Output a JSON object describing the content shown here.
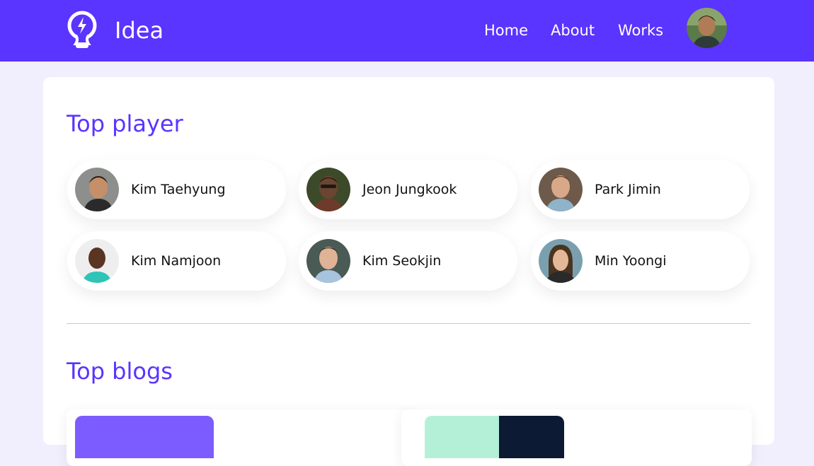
{
  "header": {
    "brand": "Idea",
    "nav": [
      {
        "label": "Home"
      },
      {
        "label": "About"
      },
      {
        "label": "Works"
      }
    ]
  },
  "top_player": {
    "title": "Top player",
    "players": [
      {
        "name": "Kim Taehyung"
      },
      {
        "name": "Jeon Jungkook"
      },
      {
        "name": "Park Jimin"
      },
      {
        "name": "Kim Namjoon"
      },
      {
        "name": "Kim Seokjin"
      },
      {
        "name": "Min Yoongi"
      }
    ]
  },
  "top_blogs": {
    "title": "Top blogs"
  },
  "colors": {
    "brand": "#5a34ff",
    "page_background": "#f1effe",
    "card_background": "#ffffff"
  }
}
